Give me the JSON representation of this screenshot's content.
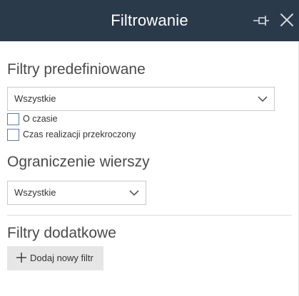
{
  "header": {
    "title": "Filtrowanie",
    "pin_icon": "pin-icon",
    "close_icon": "close-icon",
    "background": "#2b3a4a"
  },
  "predefined": {
    "title": "Filtry predefiniowane",
    "select_value": "Wszystkie",
    "checkboxes": [
      {
        "label": "O czasie",
        "checked": false
      },
      {
        "label": "Czas realizacji przekroczony",
        "checked": false
      }
    ]
  },
  "row_limit": {
    "title": "Ograniczenie wierszy",
    "select_value": "Wszystkie"
  },
  "additional": {
    "title": "Filtry dodatkowe",
    "add_button_label": "Dodaj nowy filtr",
    "add_icon": "plus-icon"
  }
}
